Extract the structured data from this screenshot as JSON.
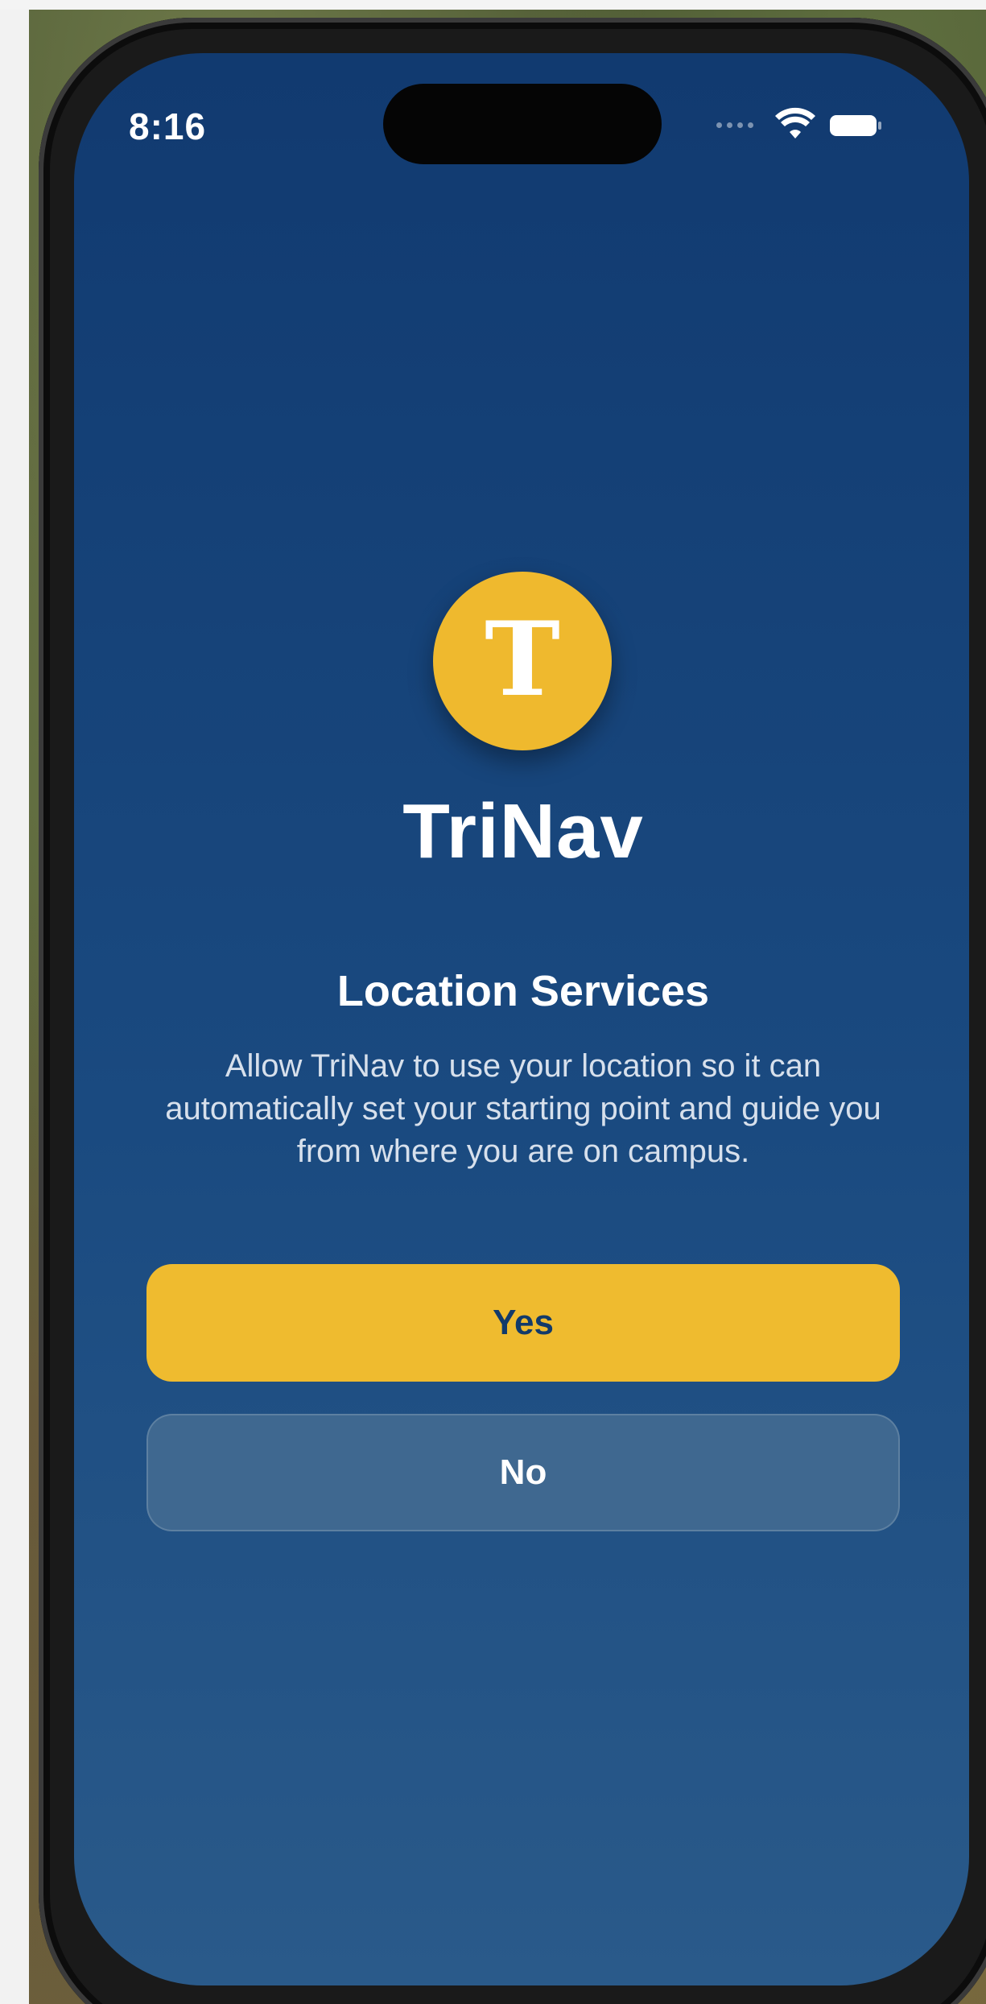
{
  "status_bar": {
    "time": "8:16",
    "signal_icon": "signal-dots-icon",
    "wifi_icon": "wifi-icon",
    "battery_icon": "battery-icon"
  },
  "app": {
    "logo_letter": "T",
    "logo_icon": "app-logo-icon",
    "name": "TriNav"
  },
  "permission": {
    "title": "Location Services",
    "description": "Allow TriNav to use your location so it can automatically set your starting point and guide you from where you are on campus."
  },
  "actions": {
    "yes_label": "Yes",
    "no_label": "No"
  },
  "colors": {
    "background_top": "#113a70",
    "background_bottom": "#2a5a8a",
    "accent": "#efb92e",
    "yes_text": "#123a6a",
    "secondary_button": "#3f6890"
  }
}
